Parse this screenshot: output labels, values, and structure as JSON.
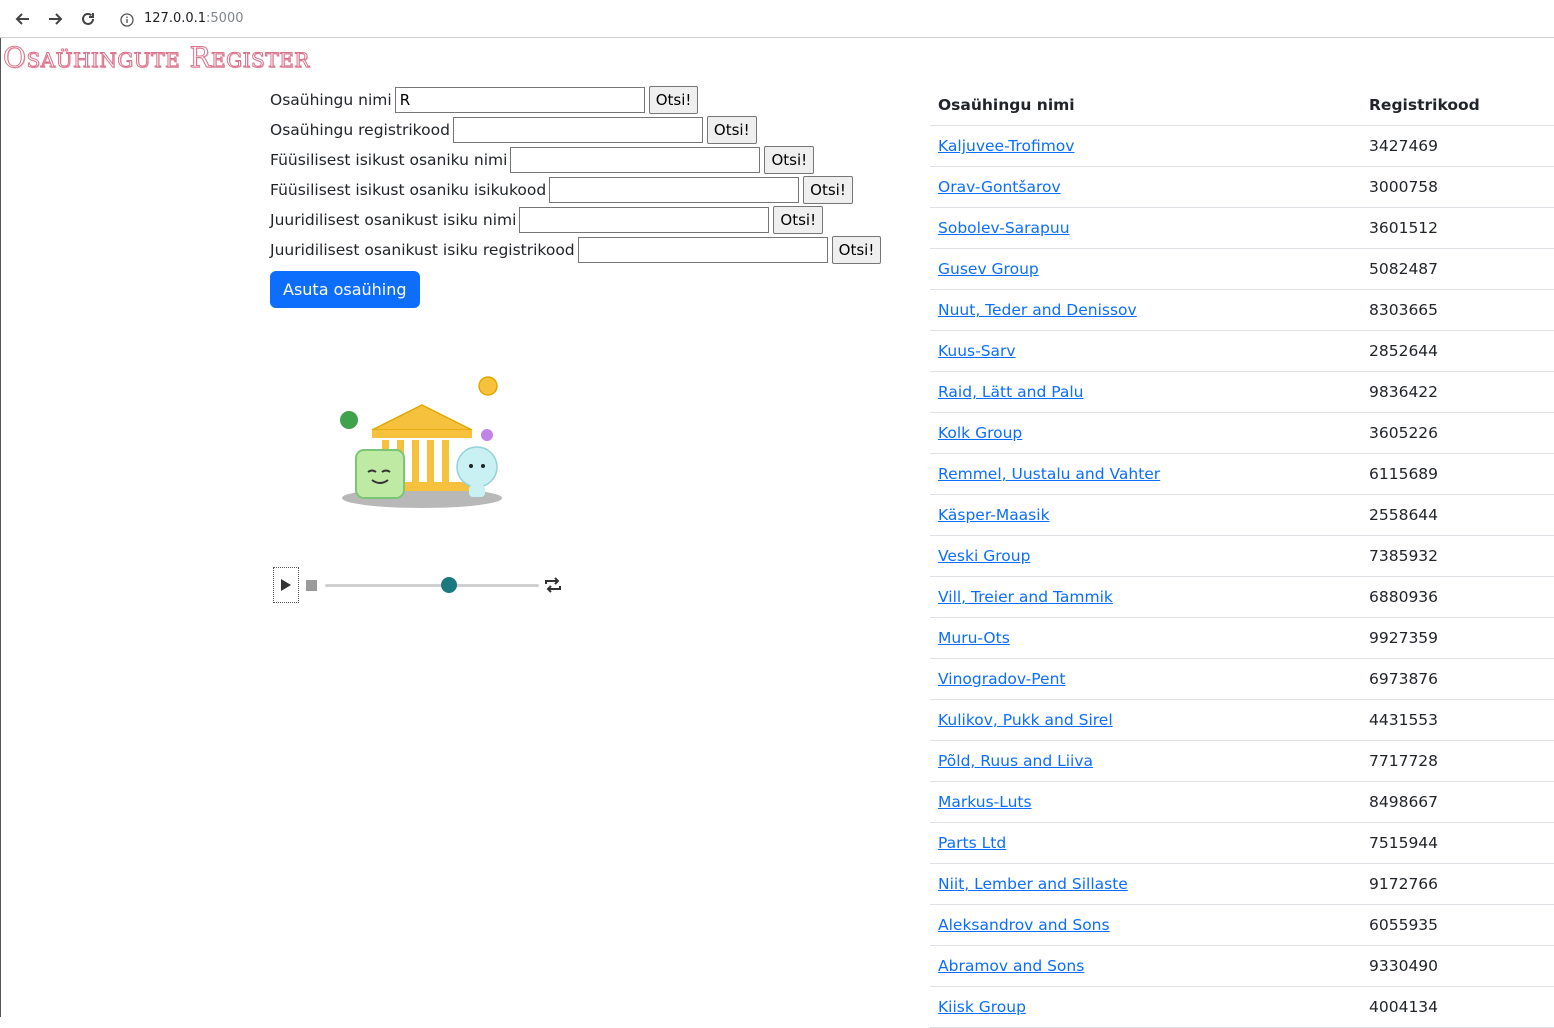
{
  "browser": {
    "url_host": "127.0.0.1",
    "url_port": ":5000"
  },
  "brand": "Osaühingute Register",
  "search_form": {
    "fields": [
      {
        "label": "Osaühingu nimi",
        "value": "R",
        "button": "Otsi!"
      },
      {
        "label": "Osaühingu registrikood",
        "value": "",
        "button": "Otsi!"
      },
      {
        "label": "Füüsilisest isikust osaniku nimi",
        "value": "",
        "button": "Otsi!"
      },
      {
        "label": "Füüsilisest isikust osaniku isikukood",
        "value": "",
        "button": "Otsi!"
      },
      {
        "label": "Juuridilisest osanikust isiku nimi",
        "value": "",
        "button": "Otsi!"
      },
      {
        "label": "Juuridilisest osanikust isiku registrikood",
        "value": "",
        "button": "Otsi!"
      }
    ],
    "create_button": "Asuta osaühing"
  },
  "player": {
    "progress": 0.58
  },
  "table": {
    "headers": [
      "Osaühingu nimi",
      "Registrikood"
    ],
    "rows": [
      {
        "name": "Kaljuvee-Trofimov",
        "code": "3427469"
      },
      {
        "name": "Orav-Gontšarov",
        "code": "3000758"
      },
      {
        "name": "Sobolev-Sarapuu",
        "code": "3601512"
      },
      {
        "name": "Gusev Group",
        "code": "5082487"
      },
      {
        "name": "Nuut, Teder and Denissov",
        "code": "8303665"
      },
      {
        "name": "Kuus-Sarv",
        "code": "2852644"
      },
      {
        "name": "Raid, Lätt and Palu",
        "code": "9836422"
      },
      {
        "name": "Kolk Group",
        "code": "3605226"
      },
      {
        "name": "Remmel, Uustalu and Vahter",
        "code": "6115689"
      },
      {
        "name": "Käsper-Maasik",
        "code": "2558644"
      },
      {
        "name": "Veski Group",
        "code": "7385932"
      },
      {
        "name": "Vill, Treier and Tammik",
        "code": "6880936"
      },
      {
        "name": "Muru-Ots",
        "code": "9927359"
      },
      {
        "name": "Vinogradov-Pent",
        "code": "6973876"
      },
      {
        "name": "Kulikov, Pukk and Sirel",
        "code": "4431553"
      },
      {
        "name": "Põld, Ruus and Liiva",
        "code": "7717728"
      },
      {
        "name": "Markus-Luts",
        "code": "8498667"
      },
      {
        "name": "Parts Ltd",
        "code": "7515944"
      },
      {
        "name": "Niit, Lember and Sillaste",
        "code": "9172766"
      },
      {
        "name": "Aleksandrov and Sons",
        "code": "6055935"
      },
      {
        "name": "Abramov and Sons",
        "code": "9330490"
      },
      {
        "name": "Kiisk Group",
        "code": "4004134"
      }
    ]
  }
}
